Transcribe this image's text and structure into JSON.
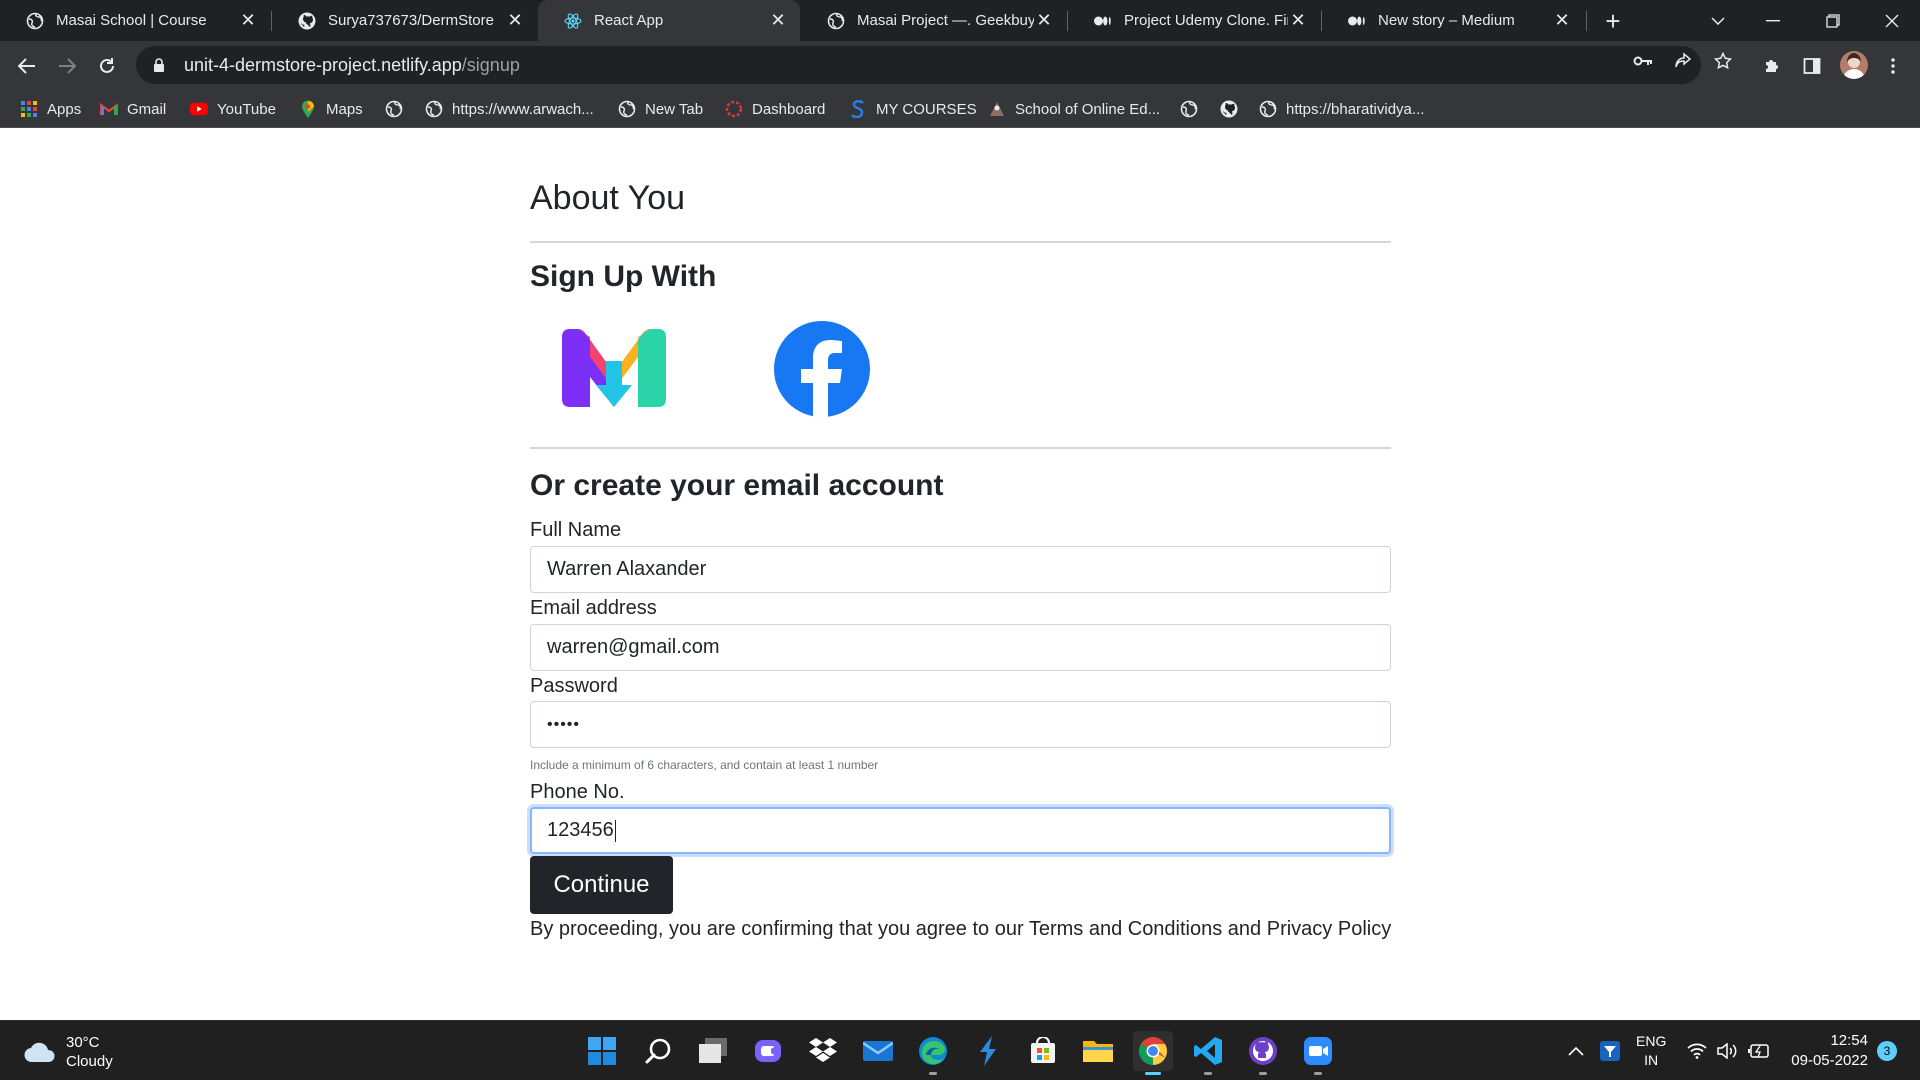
{
  "browser": {
    "tabs": [
      {
        "title": "Masai School | Course",
        "icon": "globe-icon",
        "active": false
      },
      {
        "title": "Surya737673/DermStore",
        "icon": "github-icon",
        "active": false
      },
      {
        "title": "React App",
        "icon": "react-icon",
        "active": true
      },
      {
        "title": "Masai Project —. Geekbuying",
        "icon": "globe-icon",
        "active": false
      },
      {
        "title": "Project Udemy Clone. First",
        "icon": "medium-icon",
        "active": false
      },
      {
        "title": "New story – Medium",
        "icon": "medium-icon",
        "active": false
      }
    ],
    "new_tab_label": "+",
    "url_host": "unit-4-dermstore-project.netlify.app",
    "url_path": "/signup",
    "bookmarks": [
      {
        "label": "Apps",
        "icon": "apps-grid-icon"
      },
      {
        "label": "Gmail",
        "icon": "gmail-icon"
      },
      {
        "label": "YouTube",
        "icon": "youtube-icon"
      },
      {
        "label": "Maps",
        "icon": "maps-icon"
      },
      {
        "label": "",
        "icon": "globe-icon"
      },
      {
        "label": "https://www.arwach...",
        "icon": "globe-icon"
      },
      {
        "label": "New Tab",
        "icon": "globe-icon"
      },
      {
        "label": "Dashboard",
        "icon": "dashboard-icon"
      },
      {
        "label": "MY COURSES",
        "icon": "courses-icon"
      },
      {
        "label": "School of Online Ed...",
        "icon": "school-icon"
      },
      {
        "label": "",
        "icon": "globe-icon"
      },
      {
        "label": "",
        "icon": "github-icon"
      },
      {
        "label": "https://bharatividya...",
        "icon": "globe-icon"
      }
    ]
  },
  "page": {
    "about_heading": "About You",
    "signup_with_heading": "Sign Up With",
    "social_buttons": [
      {
        "name": "masai",
        "icon": "masai-m-logo-icon"
      },
      {
        "name": "facebook",
        "icon": "facebook-icon"
      }
    ],
    "create_heading": "Or create your email account",
    "fields": {
      "full_name": {
        "label": "Full Name",
        "value": "Warren Alaxander"
      },
      "email": {
        "label": "Email address",
        "value": "warren@gmail.com"
      },
      "password": {
        "label": "Password",
        "value": "•••••"
      },
      "phone": {
        "label": "Phone No.",
        "value": "123456"
      }
    },
    "password_hint": "Include a minimum of 6 characters, and contain at least 1 number",
    "continue_label": "Continue",
    "legal_text": "By proceeding, you are confirming that you agree to our Terms and Conditions and Privacy Policy"
  },
  "taskbar": {
    "weather_temp": "30°C",
    "weather_desc": "Cloudy",
    "apps": [
      "start-icon",
      "search-icon",
      "task-view-icon",
      "chat-icon",
      "dropbox-icon",
      "mail-icon",
      "edge-icon",
      "vscode-insiders-icon",
      "store-icon",
      "file-explorer-icon",
      "chrome-icon",
      "vscode-icon",
      "github-desktop-icon",
      "zoom-icon"
    ],
    "lang_line1": "ENG",
    "lang_line2": "IN",
    "time": "12:54",
    "date": "09-05-2022",
    "notification_count": "3"
  },
  "colors": {
    "button_bg": "#212529",
    "focus_border": "#86b7fe",
    "facebook_blue": "#1877f2"
  }
}
